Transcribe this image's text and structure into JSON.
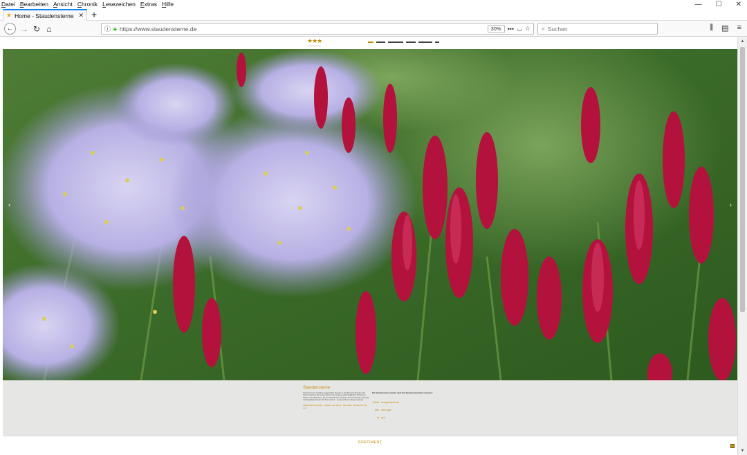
{
  "menu": [
    "Datei",
    "Bearbeiten",
    "Ansicht",
    "Chronik",
    "Lesezeichen",
    "Extras",
    "Hilfe"
  ],
  "tab": {
    "title": "Home - Staudensterne - Empf",
    "icon": "star-icon"
  },
  "window_controls": [
    "—",
    "☐",
    "✕"
  ],
  "urlbar": {
    "url": "https://www.staudensterne.de",
    "zoom": "30%"
  },
  "search": {
    "placeholder": "Suchen"
  },
  "site": {
    "logo_stars": "★★★",
    "logo_sub": "staudensterne",
    "intro_title": "Staudensterne",
    "intro_text": "Staudensterne empfehlen ausgewählte Stauden in drei Bewertungsstufen. Die Sterne bewerten die besten Sorten einer Gattung nach langjähriger Sichtung in Gärten und Gärtnereien. Mit den Staudensternen finden Sie zuverlässige, gesunde und langlebige Stauden für Ihren Garten – ausgezeichnet, sehr gut oder gut.",
    "intro_link": "Staudensichtung 2011 · Angaben des Sterns · das stellen Sie bitte hier den Link",
    "legend_head": "Die Staudensterne werden nach drei Bewertungsstufen vergeben:",
    "ratings": [
      {
        "stars": "★★★",
        "label": "ausgezeichnet"
      },
      {
        "stars": "★★",
        "label": "sehr gut"
      },
      {
        "stars": "★",
        "label": "gut"
      }
    ],
    "sortiment": "SORTIMENT"
  },
  "colors": {
    "accent": "#c4900f",
    "tab_highlight": "#0a84ff",
    "band": "#e6e6e4"
  }
}
